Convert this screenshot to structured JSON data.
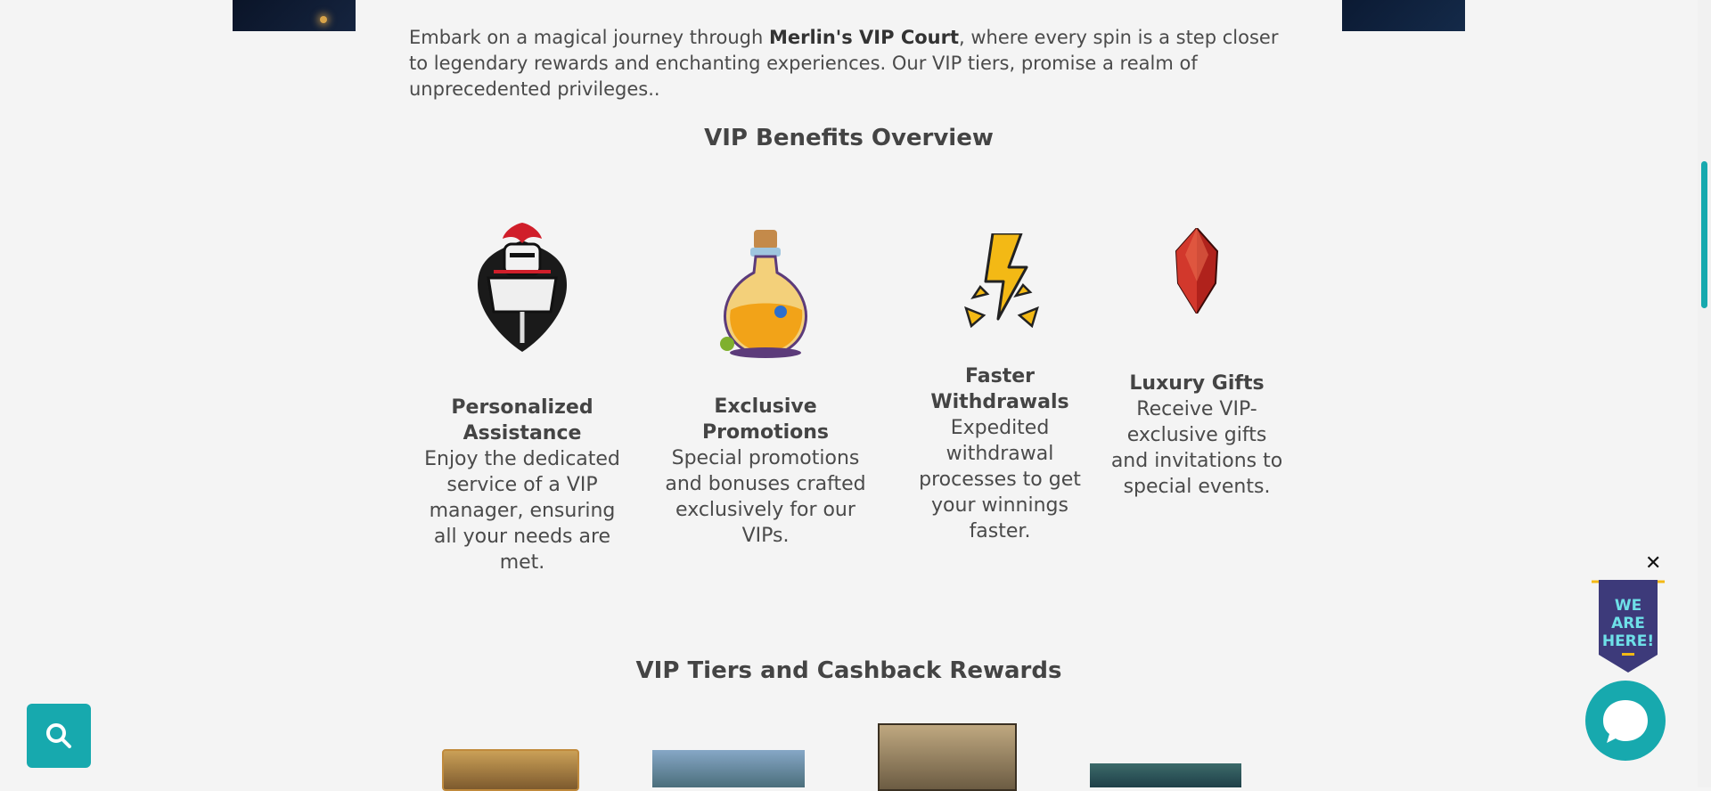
{
  "intro": {
    "text_before": "Embark on a magical journey through ",
    "brand": "Merlin's VIP Court",
    "text_after": ", where every spin is a step closer to legendary rewards and enchanting experiences. Our VIP tiers, promise a realm of unprecedented privileges.."
  },
  "benefits_heading": "VIP Benefits Overview",
  "benefits": [
    {
      "icon": "knight-shield-icon",
      "title": "Personalized Assistance",
      "desc": "Enjoy the dedicated service of a VIP manager, ensuring all your needs are met."
    },
    {
      "icon": "potion-bottle-icon",
      "title": "Exclusive Promotions",
      "desc": "Special promotions and bonuses crafted exclusively for our VIPs."
    },
    {
      "icon": "lightning-bolt-icon",
      "title": "Faster Withdrawals",
      "desc": "Expedited withdrawal processes to get your winnings faster."
    },
    {
      "icon": "red-crystal-icon",
      "title": "Luxury Gifts",
      "desc": "Receive VIP-exclusive gifts and invitations to special events."
    }
  ],
  "tiers_heading": "VIP Tiers and Cashback Rewards",
  "widget": {
    "banner_text": [
      "WE",
      "ARE",
      "HERE!"
    ],
    "close_label": "✕"
  },
  "colors": {
    "accent": "#17a9ae",
    "banner": "#3d3a7a",
    "banner_text": "#6ee0e8",
    "gold": "#f3b915"
  }
}
